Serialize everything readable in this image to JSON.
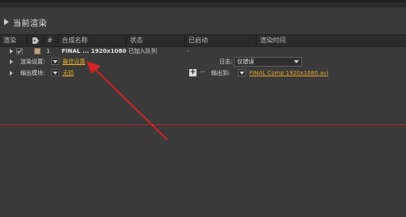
{
  "panel": {
    "title": "当前渲染"
  },
  "columns": {
    "render": "渲染",
    "tag": "",
    "num": "#",
    "comp_name": "合成名称",
    "status": "状态",
    "started": "已启动",
    "render_time": "渲染时间"
  },
  "queue_item": {
    "num": "1",
    "comp_name": "FINAL ... 1920x1080",
    "status": "已加入队列",
    "started": "-",
    "render_time": ""
  },
  "render_settings": {
    "label": "渲染设置:",
    "value": "最佳设置",
    "log_label": "日志:",
    "log_value": "仅错误"
  },
  "output_module": {
    "label": "输出模块:",
    "value": "无损",
    "plus": "+",
    "minus": "−",
    "output_to_label": "输出到:",
    "output_to_value": "FINAL Comp 1920x1080.avi"
  },
  "icons": {
    "tag": "tag-icon",
    "checkbox": "check-icon"
  },
  "colors": {
    "link": "#e2a82b",
    "arrow": "#d22424",
    "time_marker": "#b21f1f"
  }
}
